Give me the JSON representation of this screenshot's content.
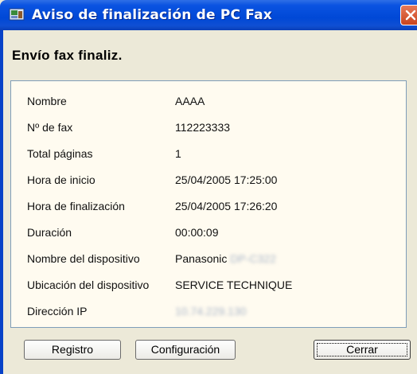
{
  "window": {
    "title": "Aviso de finalización de PC Fax"
  },
  "heading": "Envío fax finaliz.",
  "details": [
    {
      "label": "Nombre",
      "value": "AAAA"
    },
    {
      "label": "Nº de fax",
      "value": "112223333"
    },
    {
      "label": "Total páginas",
      "value": "1"
    },
    {
      "label": "Hora de inicio",
      "value": "25/04/2005 17:25:00"
    },
    {
      "label": "Hora de finalización",
      "value": "25/04/2005 17:26:20"
    },
    {
      "label": "Duración",
      "value": "00:00:09"
    },
    {
      "label": "Nombre del dispositivo",
      "value": "Panasonic",
      "value_blurred": "DP-C322"
    },
    {
      "label": "Ubicación del dispositivo",
      "value": "SERVICE TECHNIQUE"
    },
    {
      "label": "Dirección IP",
      "value_blurred": "10.74.229.130"
    }
  ],
  "buttons": {
    "log": "Registro",
    "config": "Configuración",
    "close": "Cerrar"
  }
}
